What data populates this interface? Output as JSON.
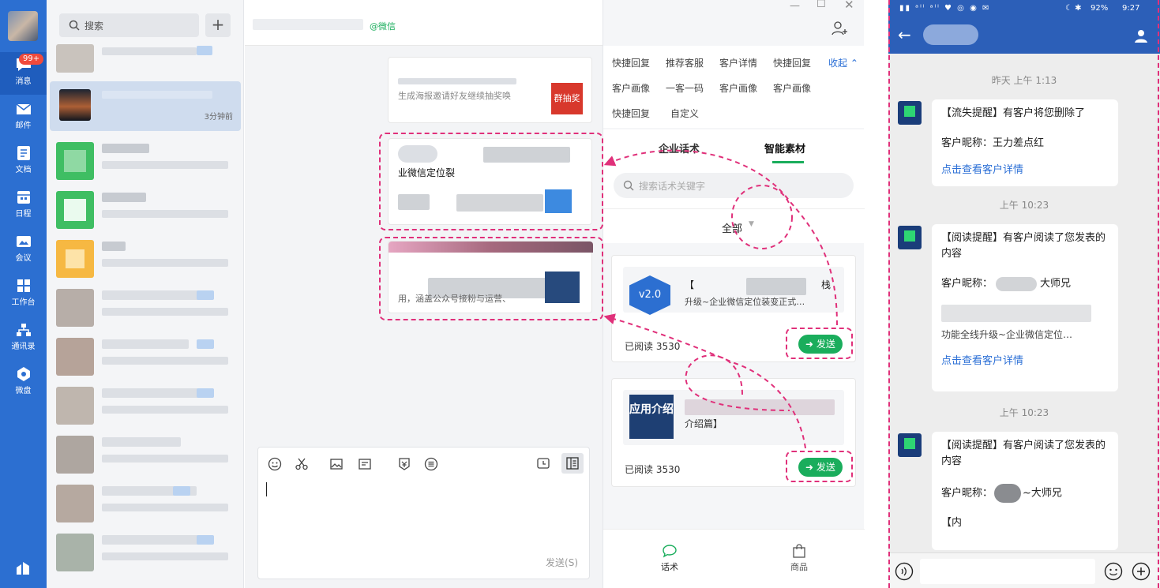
{
  "rail": {
    "badge": "99+",
    "items": [
      "消息",
      "邮件",
      "文档",
      "日程",
      "会议",
      "工作台",
      "通讯录",
      "微盘"
    ]
  },
  "list": {
    "search_placeholder": "搜索",
    "add_symbol": "+",
    "active_time": "3分钟前"
  },
  "chat": {
    "header_tag": "@微信",
    "msg1_text": "生成海报邀请好友继续抽奖唤",
    "msg1_thumb": "群抽奖",
    "msg2_title": "业微信定位裂",
    "msg3_text": "用，涵盖公众号接粉与运营、",
    "send_label": "发送(S)"
  },
  "panel": {
    "tags_row1": [
      "快捷回复",
      "推荐客服",
      "客户详情",
      "快捷回复"
    ],
    "collapse": "收起",
    "tags_row2": [
      "客户画像",
      "一客一码",
      "客户画像",
      "客户画像"
    ],
    "tags_row3": [
      "快捷回复",
      "自定义"
    ],
    "tabs": [
      "企业话术",
      "智能素材"
    ],
    "search_placeholder": "搜索话术关键字",
    "filter": "全部",
    "card1_badge": "v2.0",
    "card1_title": "【",
    "card1_title_end": "栈",
    "card1_desc": "升级~企业微信定位装变正式…",
    "card1_reads": "已阅读 3530",
    "card2_thumb": "应用介绍",
    "card2_desc": "介绍篇】",
    "card2_reads": "已阅读 3530",
    "send_btn": "发送",
    "bottom_tabs": [
      "话术",
      "商品"
    ]
  },
  "phone": {
    "status_right": "92%",
    "status_time": "9:27",
    "time1": "昨天 上午 1:13",
    "msg1_title": "【流失提醒】有客户将您删除了",
    "msg1_nick": "客户昵称：王力差点红",
    "msg1_link": "点击查看客户详情",
    "time2": "上午 10:23",
    "msg2_title": "【阅读提醒】有客户阅读了您发表的内容",
    "msg2_nick_prefix": "客户昵称：",
    "msg2_nick_suffix": "大师兄",
    "msg2_content": "功能全线升级~企业微信定位…",
    "msg2_link": "点击查看客户详情",
    "time3": "上午 10:23",
    "msg3_title": "【阅读提醒】有客户阅读了您发表的内容",
    "msg3_nick_prefix": "客户昵称：",
    "msg3_nick_suffix": "~大师兄",
    "msg3_partial": "【内"
  }
}
